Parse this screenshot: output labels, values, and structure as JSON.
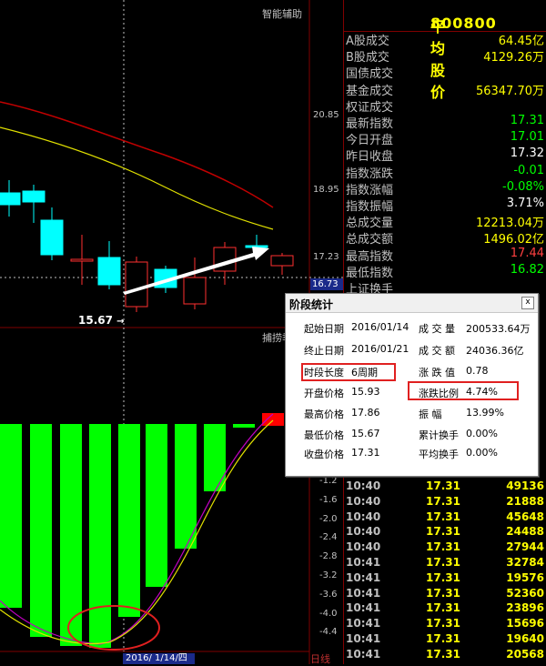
{
  "header": {
    "panel_label": "智能辅助",
    "sub_label": "捕捞季",
    "stock_code": "800800",
    "stock_name": "平均股价"
  },
  "price_axis": {
    "labels": [
      "20.85",
      "18.95",
      "17.23",
      "16.73"
    ],
    "low_label": "15.67"
  },
  "indicator_axis": {
    "labels": [
      "-1.2",
      "-1.6",
      "-2.0",
      "-2.4",
      "-2.8",
      "-3.2",
      "-3.6",
      "-4.0",
      "-4.4"
    ]
  },
  "bottom": {
    "date": "2016/ 1/14/四",
    "period": "日线"
  },
  "stats": [
    {
      "label": "A股成交",
      "value": "64.45亿",
      "color": "#ffff00"
    },
    {
      "label": "B股成交",
      "value": "4129.26万",
      "color": "#ffff00"
    },
    {
      "label": "国债成交",
      "value": "",
      "color": "#ffff00"
    },
    {
      "label": "基金成交",
      "value": "56347.70万",
      "color": "#ffff00"
    },
    {
      "label": "权证成交",
      "value": "",
      "color": "#ffff00"
    },
    {
      "label": "最新指数",
      "value": "17.31",
      "color": "#00ff00"
    },
    {
      "label": "今日开盘",
      "value": "17.01",
      "color": "#00ff00"
    },
    {
      "label": "昨日收盘",
      "value": "17.32",
      "color": "#ffffff"
    },
    {
      "label": "指数涨跌",
      "value": "-0.01",
      "color": "#00ff00"
    },
    {
      "label": "指数涨幅",
      "value": "-0.08%",
      "color": "#00ff00"
    },
    {
      "label": "指数振幅",
      "value": "3.71%",
      "color": "#ffffff"
    },
    {
      "label": "总成交量",
      "value": "12213.04万",
      "color": "#ffff00"
    },
    {
      "label": "总成交额",
      "value": "1496.02亿",
      "color": "#ffff00"
    },
    {
      "label": "最高指数",
      "value": "17.44",
      "color": "#ff4040"
    },
    {
      "label": "最低指数",
      "value": "16.82",
      "color": "#00ff00"
    },
    {
      "label": "上证换手",
      "value": "",
      "color": "#ffff00"
    }
  ],
  "ticks": [
    {
      "time": "10:40",
      "price": "17.31",
      "vol": "49136"
    },
    {
      "time": "10:40",
      "price": "17.31",
      "vol": "21888"
    },
    {
      "time": "10:40",
      "price": "17.31",
      "vol": "45648"
    },
    {
      "time": "10:40",
      "price": "17.31",
      "vol": "24488"
    },
    {
      "time": "10:40",
      "price": "17.31",
      "vol": "27944"
    },
    {
      "time": "10:41",
      "price": "17.31",
      "vol": "32784"
    },
    {
      "time": "10:41",
      "price": "17.31",
      "vol": "19576"
    },
    {
      "time": "10:41",
      "price": "17.31",
      "vol": "52360"
    },
    {
      "time": "10:41",
      "price": "17.31",
      "vol": "23896"
    },
    {
      "time": "10:41",
      "price": "17.31",
      "vol": "15696"
    },
    {
      "time": "10:41",
      "price": "17.31",
      "vol": "19640"
    },
    {
      "time": "10:41",
      "price": "17.31",
      "vol": "20568"
    }
  ],
  "dialog": {
    "title": "阶段统计",
    "close": "x",
    "left": [
      {
        "label": "起始日期",
        "value": "2016/01/14"
      },
      {
        "label": "终止日期",
        "value": "2016/01/21"
      },
      {
        "label": "时段长度",
        "value": "6周期"
      },
      {
        "label": "开盘价格",
        "value": "15.93"
      },
      {
        "label": "最高价格",
        "value": "17.86"
      },
      {
        "label": "最低价格",
        "value": "15.67"
      },
      {
        "label": "收盘价格",
        "value": "17.31"
      }
    ],
    "right": [
      {
        "label": "成 交 量",
        "value": "200533.64万"
      },
      {
        "label": "成 交 额",
        "value": "24036.36亿"
      },
      {
        "label": "涨 跌 值",
        "value": "0.78"
      },
      {
        "label": "涨跌比例",
        "value": "4.74%"
      },
      {
        "label": "振    幅",
        "value": "13.99%"
      },
      {
        "label": "累计换手",
        "value": "0.00%"
      },
      {
        "label": "平均换手",
        "value": "0.00%"
      }
    ]
  },
  "colors": {
    "up": "#ff3030",
    "down": "#00ffff",
    "bar_down": "#00ff00",
    "bar_up": "#ff0000",
    "ma_long": "#c00000",
    "ma_short": "#e0e000"
  }
}
